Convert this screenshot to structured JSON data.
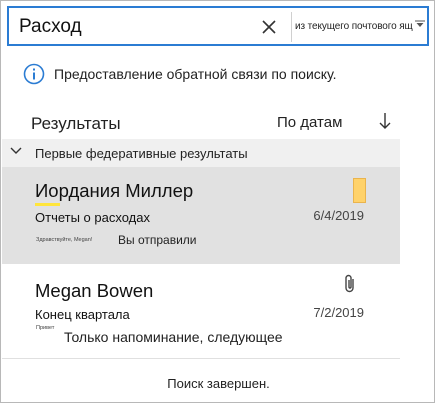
{
  "search": {
    "query": "Расход",
    "scope": "из текущего почтового ящика"
  },
  "info": {
    "message": "Предоставление обратной связи по поиску."
  },
  "results": {
    "title": "Результаты",
    "sort_label": "По датам"
  },
  "group": {
    "label": "Первые федеративные результаты"
  },
  "messages": [
    {
      "sender": "Иордания Миллер",
      "subject": "Отчеты о расходах",
      "date": "6/4/2019",
      "preview_small": "Здравствуйте, Megan!",
      "preview": "Вы отправили",
      "flag_color": "#ffd26a",
      "selected": true
    },
    {
      "sender": "Megan Bowen",
      "subject": "Конец квартала",
      "date": "7/2/2019",
      "preview_small": "Привет",
      "preview": "Только напоминание, следующее",
      "attachment": true,
      "selected": false
    }
  ],
  "status": {
    "text": "Поиск завершен."
  },
  "colors": {
    "accent": "#2b7cd3",
    "highlight": "#ffe53b",
    "selected_bg": "#e1e1e1",
    "group_bg": "#f0f0f0"
  },
  "icons": {
    "clear": "close-icon",
    "scope_dropdown": "chevron-down-icon",
    "info": "info-icon",
    "sort": "arrow-down-icon",
    "group": "chevron-down-icon",
    "flag": "flag-icon",
    "attachment": "paperclip-icon"
  }
}
